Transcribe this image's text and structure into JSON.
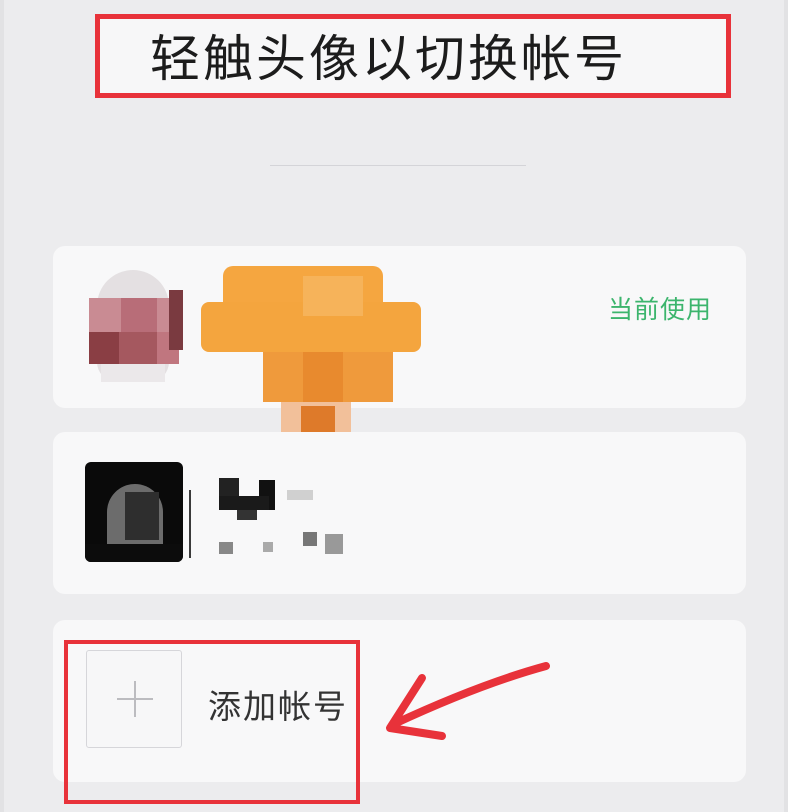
{
  "header": {
    "title": "轻触头像以切换帐号"
  },
  "accounts": [
    {
      "status": "当前使用",
      "name": ""
    },
    {
      "status": "",
      "name": ""
    }
  ],
  "add_account": {
    "label": "添加帐号"
  },
  "colors": {
    "highlight_red": "#e8323a",
    "status_green": "#3cb56d",
    "card_bg": "#f8f8f9",
    "page_bg": "#ececee"
  }
}
